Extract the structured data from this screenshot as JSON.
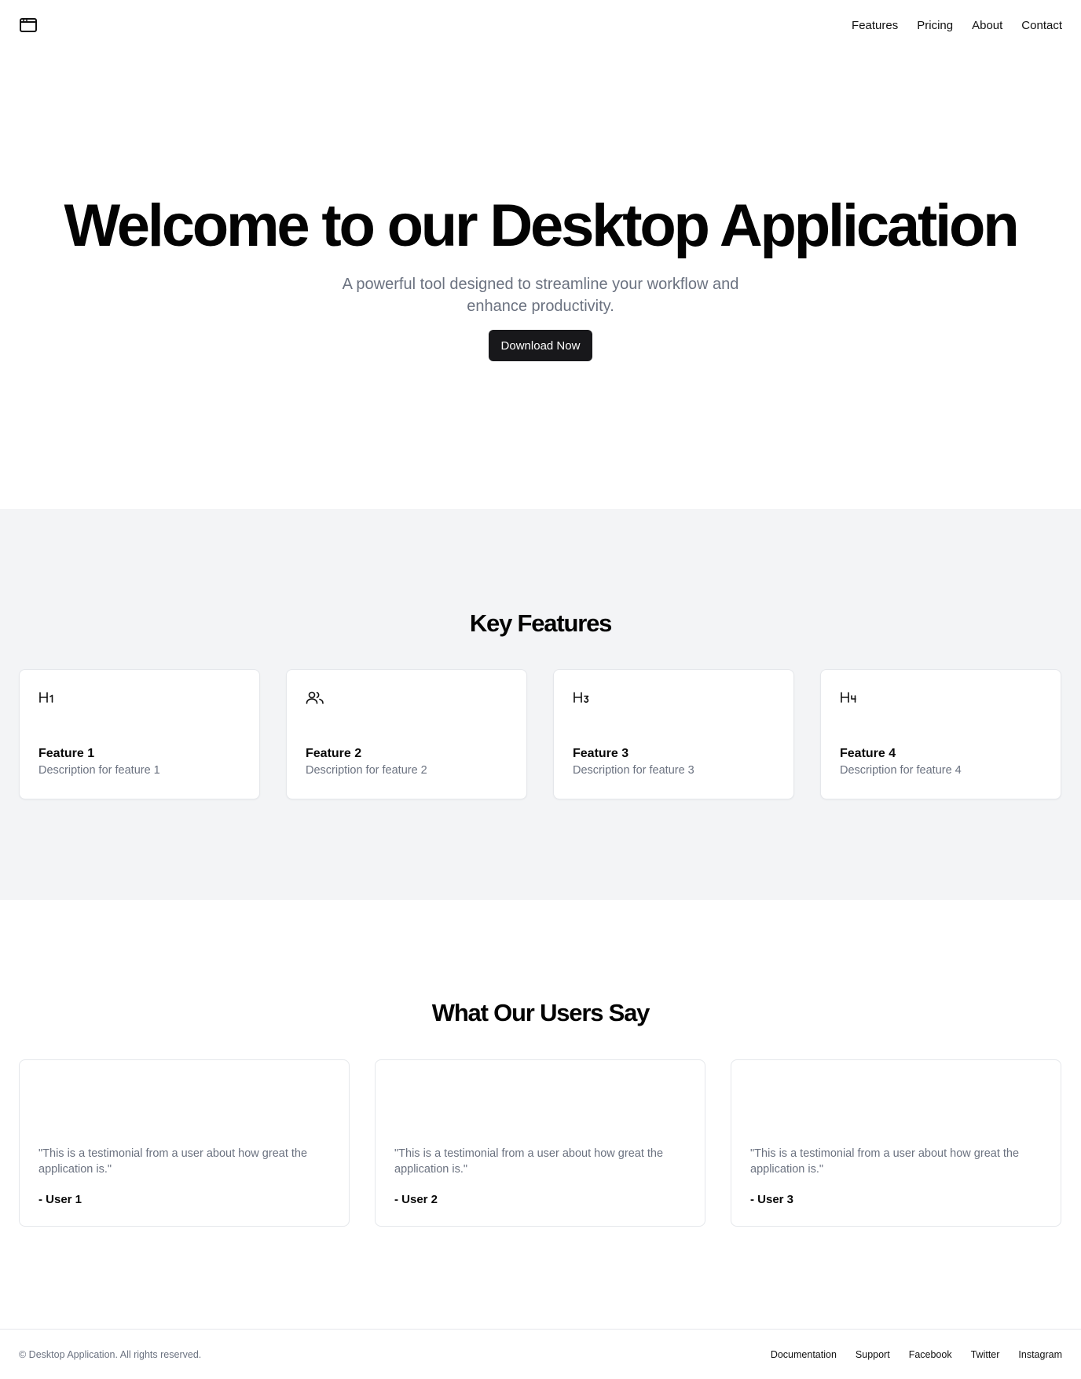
{
  "header": {
    "logo_icon": "app-window-icon",
    "nav": [
      "Features",
      "Pricing",
      "About",
      "Contact"
    ]
  },
  "hero": {
    "title": "Welcome to our Desktop Application",
    "subtitle": "A powerful tool designed to streamline your workflow and enhance productivity.",
    "cta_label": "Download Now"
  },
  "features": {
    "heading": "Key Features",
    "items": [
      {
        "icon": "heading-1-icon",
        "icon_text": "H1",
        "title": "Feature 1",
        "description": "Description for feature 1"
      },
      {
        "icon": "users-icon",
        "icon_text": "",
        "title": "Feature 2",
        "description": "Description for feature 2"
      },
      {
        "icon": "heading-3-icon",
        "icon_text": "H3",
        "title": "Feature 3",
        "description": "Description for feature 3"
      },
      {
        "icon": "heading-4-icon",
        "icon_text": "H4",
        "title": "Feature 4",
        "description": "Description for feature 4"
      }
    ]
  },
  "testimonials": {
    "heading": "What Our Users Say",
    "items": [
      {
        "quote": "\"This is a testimonial from a user about how great the application is.\"",
        "author": "- User 1"
      },
      {
        "quote": "\"This is a testimonial from a user about how great the application is.\"",
        "author": "- User 2"
      },
      {
        "quote": "\"This is a testimonial from a user about how great the application is.\"",
        "author": "- User 3"
      }
    ]
  },
  "footer": {
    "copyright": "© Desktop Application. All rights reserved.",
    "links": [
      "Documentation",
      "Support",
      "Facebook",
      "Twitter",
      "Instagram"
    ]
  },
  "colors": {
    "primary_button": "#18181b",
    "muted_text": "#6b7280",
    "section_bg": "#f3f4f6",
    "border": "#e5e7eb"
  }
}
